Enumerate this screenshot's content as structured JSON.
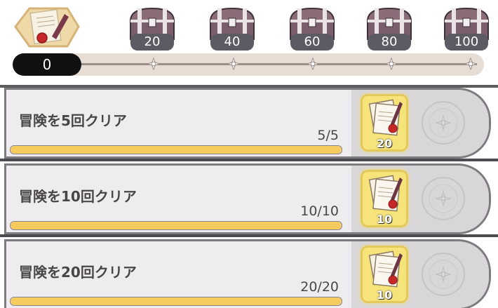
{
  "track": {
    "current_points": "0",
    "milestones": [
      {
        "label": "20",
        "icon": "treasure-chest-icon"
      },
      {
        "label": "40",
        "icon": "treasure-chest-icon"
      },
      {
        "label": "60",
        "icon": "treasure-chest-icon"
      },
      {
        "label": "80",
        "icon": "treasure-chest-icon"
      },
      {
        "label": "100",
        "icon": "treasure-chest-icon"
      }
    ],
    "colors": {
      "current_pill": "#111111",
      "track": "#e7ddd5"
    }
  },
  "missions": [
    {
      "title": "冒険を5回クリア",
      "progress_text": "5/5",
      "progress_fraction": 1.0,
      "reward_qty": "20",
      "reward_icon": "scroll-letter-icon"
    },
    {
      "title": "冒険を10回クリア",
      "progress_text": "10/10",
      "progress_fraction": 1.0,
      "reward_qty": "10",
      "reward_icon": "scroll-letter-icon"
    },
    {
      "title": "冒険を20回クリア",
      "progress_text": "20/20",
      "progress_fraction": 1.0,
      "reward_qty": "10",
      "reward_icon": "scroll-letter-icon"
    }
  ],
  "colors": {
    "progress_fill": "#f5cb60",
    "reward_highlight": "#f6e47a"
  }
}
